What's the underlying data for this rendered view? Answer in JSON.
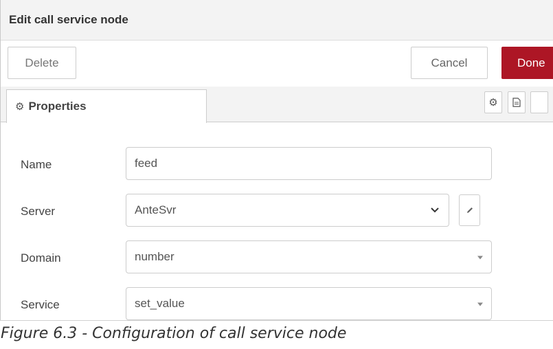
{
  "dialog": {
    "title": "Edit call service node",
    "buttons": {
      "delete_label": "Delete",
      "cancel_label": "Cancel",
      "done_label": "Done"
    },
    "tabs": {
      "properties_label": "Properties"
    },
    "form": {
      "name": {
        "label": "Name",
        "value": "feed"
      },
      "server": {
        "label": "Server",
        "value": "AnteSvr"
      },
      "domain": {
        "label": "Domain",
        "value": "number"
      },
      "service": {
        "label": "Service",
        "value": "set_value"
      }
    },
    "colors": {
      "done_button": "#ad1625",
      "header_background": "#f3f3f3"
    },
    "icons": [
      "gear-icon",
      "document-icon",
      "pencil-icon",
      "chevron-down-icon",
      "dropdown-caret-icon"
    ]
  },
  "caption": "Figure 6.3 - Configuration of call service node"
}
